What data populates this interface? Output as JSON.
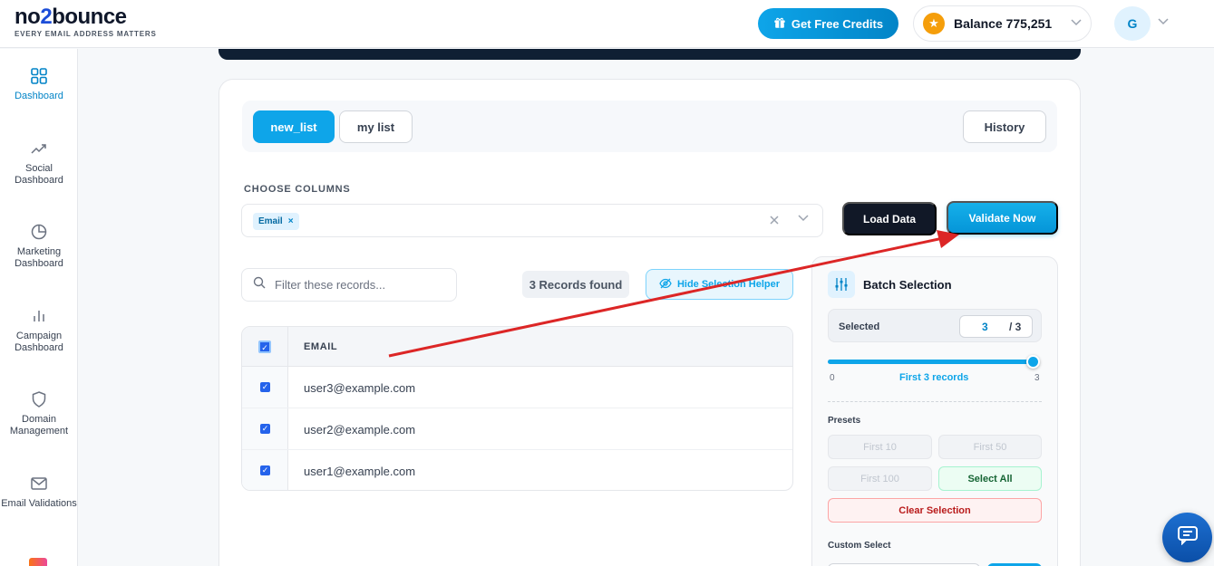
{
  "brand": {
    "name_pre": "no",
    "name_mid": "2",
    "name_post": "bounce",
    "tagline": "EVERY EMAIL ADDRESS MATTERS"
  },
  "header": {
    "credits_label": "Get Free Credits",
    "balance_label": "Balance 775,251",
    "avatar_initial": "G"
  },
  "sidebar": {
    "items": [
      {
        "label": "Dashboard",
        "icon": "grid-icon",
        "active": true
      },
      {
        "label": "Social Dashboard",
        "icon": "trend-icon"
      },
      {
        "label": "Marketing Dashboard",
        "icon": "pie-icon"
      },
      {
        "label": "Campaign Dashboard",
        "icon": "bars-icon"
      },
      {
        "label": "Domain Management",
        "icon": "shield-icon"
      },
      {
        "label": "Email Validations",
        "icon": "mail-icon"
      }
    ]
  },
  "tabs": [
    {
      "label": "new_list",
      "active": true
    },
    {
      "label": "my list",
      "active": false
    }
  ],
  "history_label": "History",
  "columns": {
    "label": "CHOOSE COLUMNS",
    "selected": [
      "Email"
    ]
  },
  "actions": {
    "load": "Load Data",
    "validate": "Validate Now"
  },
  "filter": {
    "placeholder": "Filter these records..."
  },
  "records_found": "3 Records found",
  "hide_helper": "Hide Selection Helper",
  "table": {
    "header": "EMAIL",
    "rows": [
      {
        "email": "user3@example.com",
        "checked": true
      },
      {
        "email": "user2@example.com",
        "checked": true
      },
      {
        "email": "user1@example.com",
        "checked": true
      }
    ]
  },
  "batch": {
    "title": "Batch Selection",
    "selected_label": "Selected",
    "selected_count": "3",
    "selected_total": "/ 3",
    "slider": {
      "min": "0",
      "max": "3",
      "value": 3,
      "caption": "First 3 records"
    },
    "presets_label": "Presets",
    "presets": [
      "First 10",
      "First 50",
      "First 100",
      "Select All"
    ],
    "clear_label": "Clear Selection",
    "custom_label": "Custom Select"
  },
  "colors": {
    "accent": "#0ea5e9",
    "dark": "#111827",
    "arrow": "#dc2626"
  }
}
